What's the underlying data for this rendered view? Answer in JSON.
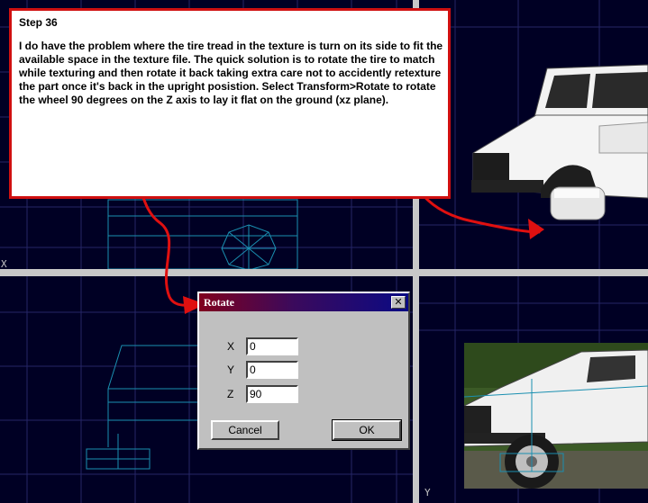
{
  "callout": {
    "title": "Step 36",
    "body": "I do have the problem where the tire tread in the texture is turn on its side to fit the available space in the texture file. The quick solution is to rotate the tire to match while texturing and then rotate it back taking extra care not to accidently retexture the part once it's back in the upright posistion. Select Transform>Rotate to rotate the wheel 90 degrees on the Z axis to lay it flat on the ground (xz plane).",
    "border_color": "#d01010"
  },
  "viewports": {
    "axis_x_label": "X",
    "axis_y_label": "Y",
    "background": "#000024",
    "grid_color": "#2a2a6a",
    "wire_color": "#1a8fb0"
  },
  "dialog": {
    "title": "Rotate",
    "close_glyph": "✕",
    "fields": [
      {
        "label": "X",
        "value": "0"
      },
      {
        "label": "Y",
        "value": "0"
      },
      {
        "label": "Z",
        "value": "90"
      }
    ],
    "cancel_label": "Cancel",
    "ok_label": "OK"
  },
  "arrows": {
    "color": "#e01010"
  }
}
